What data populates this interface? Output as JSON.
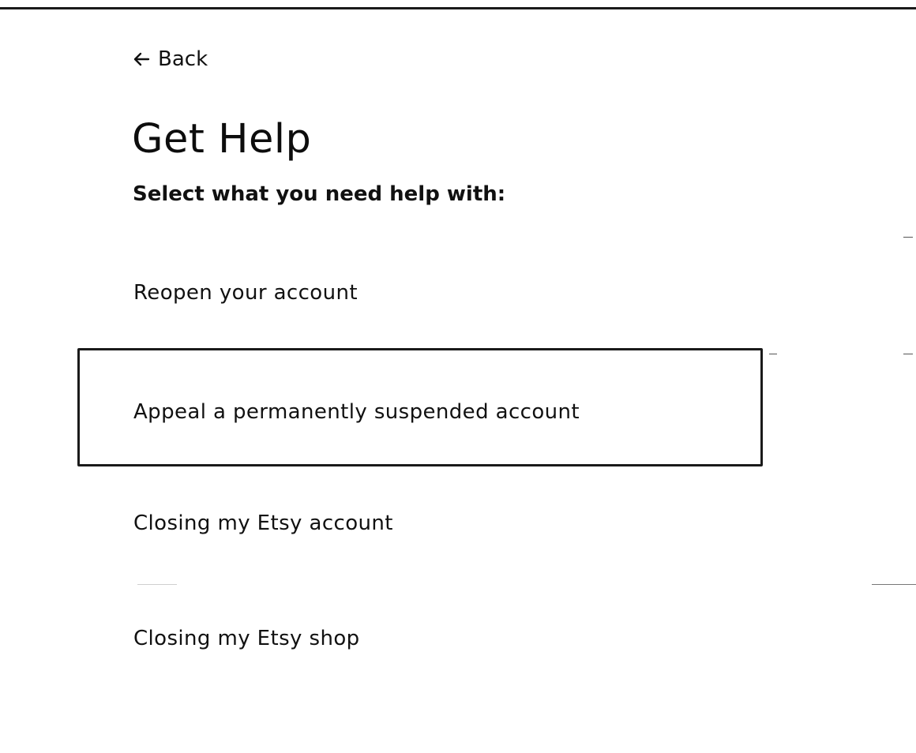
{
  "back": {
    "label": "Back",
    "icon": "arrow-left-icon"
  },
  "page": {
    "title": "Get Help",
    "subtitle": "Select what you need help with:"
  },
  "options": [
    {
      "label": "Reopen your account",
      "focused": false
    },
    {
      "label": "Appeal a permanently suspended account",
      "focused": true
    },
    {
      "label": "Closing my Etsy account",
      "focused": false
    },
    {
      "label": "Closing my Etsy shop",
      "focused": false
    }
  ],
  "colors": {
    "text": "#111111",
    "border": "#1a1a1a",
    "background": "#ffffff"
  }
}
